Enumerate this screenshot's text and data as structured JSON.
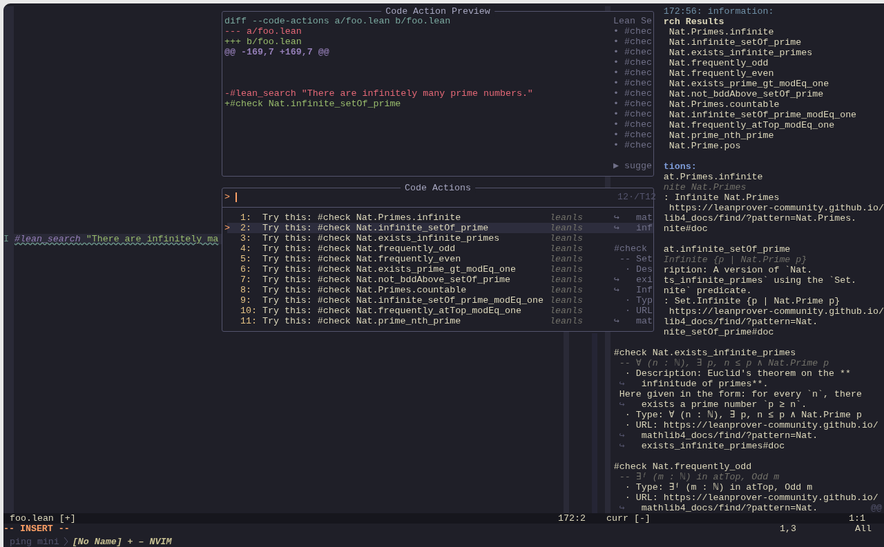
{
  "editor": {
    "file_line": {
      "sign": "I",
      "segments": [
        {
          "kind": "keyword",
          "text": "#lean_search"
        },
        {
          "kind": "string",
          "text": " \"There are infinitely ma"
        }
      ]
    }
  },
  "preview": {
    "title": "Code Action Preview",
    "lines": [
      {
        "kind": "header",
        "text": "diff --code-actions a/foo.lean b/foo.lean",
        "underlay": "Lean Se"
      },
      {
        "kind": "removed",
        "text": "--- a/foo.lean",
        "underlay": "• #chec"
      },
      {
        "kind": "added",
        "text": "+++ b/foo.lean",
        "underlay": "• #chec"
      },
      {
        "kind": "hunk",
        "text": "@@ -169,7 +169,7 @@",
        "underlay": "• #chec"
      },
      {
        "kind": "blank",
        "underlay": "• #chec"
      },
      {
        "kind": "blank",
        "underlay": "• #chec"
      },
      {
        "kind": "blank",
        "underlay": "• #chec"
      },
      {
        "kind": "removed",
        "text": "-#lean_search \"There are infinitely many prime numbers.\"",
        "underlay": "• #chec"
      },
      {
        "kind": "added",
        "text": "+#check Nat.infinite_setOf_prime",
        "underlay": "• #chec"
      },
      {
        "kind": "blank",
        "underlay": "• #chec"
      },
      {
        "kind": "blank",
        "underlay": "• #chec"
      },
      {
        "kind": "blank",
        "underlay": "• #chec"
      },
      {
        "kind": "blank",
        "underlay": "• #chec"
      },
      {
        "kind": "blank"
      },
      {
        "kind": "blank",
        "underlay": "▶ sugge"
      }
    ]
  },
  "code_actions": {
    "title": "Code Actions",
    "prompt": ">",
    "counter": "12·/T12",
    "items": [
      {
        "number": "1:",
        "title": "Try this: #check Nat.Primes.infinite",
        "source": "leanls",
        "selected": false,
        "underlay": "↪   mat"
      },
      {
        "number": "2:",
        "title": "Try this: #check Nat.infinite_setOf_prime",
        "source": "leanls",
        "selected": true,
        "marker": ">",
        "underlay": "↪   inf"
      },
      {
        "number": "3:",
        "title": "Try this: #check Nat.exists_infinite_primes",
        "source": "leanls",
        "selected": false
      },
      {
        "number": "4:",
        "title": "Try this: #check Nat.frequently_odd",
        "source": "leanls",
        "selected": false,
        "underlay": "#check"
      },
      {
        "number": "5:",
        "title": "Try this: #check Nat.frequently_even",
        "source": "leanls",
        "selected": false,
        "underlay": " -- Set"
      },
      {
        "number": "6:",
        "title": "Try this: #check Nat.exists_prime_gt_modEq_one",
        "source": "leanls",
        "selected": false,
        "underlay": "  · Des"
      },
      {
        "number": "7:",
        "title": "Try this: #check Nat.not_bddAbove_setOf_prime",
        "source": "leanls",
        "selected": false,
        "underlay": "↪   exi"
      },
      {
        "number": "8:",
        "title": "Try this: #check Nat.Primes.countable",
        "source": "leanls",
        "selected": false,
        "underlay": "↪   Inf"
      },
      {
        "number": "9:",
        "title": "Try this: #check Nat.infinite_setOf_prime_modEq_one",
        "source": "leanls",
        "selected": false,
        "underlay": "  · Typ"
      },
      {
        "number": "10:",
        "title": "Try this: #check Nat.frequently_atTop_modEq_one",
        "source": "leanls",
        "selected": false,
        "underlay": "  · URL"
      },
      {
        "number": "11:",
        "title": "Try this: #check Nat.prime_nth_prime",
        "source": "leanls",
        "selected": false,
        "underlay": "↪   mat"
      }
    ]
  },
  "infoview": {
    "covered_lines": [
      {
        "kind": "info",
        "text": "172:56: information:"
      },
      {
        "kind": "heading",
        "text": "rch Results"
      },
      {
        "kind": "text",
        "text": " Nat.Primes.infinite"
      },
      {
        "kind": "text",
        "text": " Nat.infinite_setOf_prime"
      },
      {
        "kind": "text",
        "text": " Nat.exists_infinite_primes"
      },
      {
        "kind": "text",
        "text": " Nat.frequently_odd"
      },
      {
        "kind": "text",
        "text": " Nat.frequently_even"
      },
      {
        "kind": "text",
        "text": " Nat.exists_prime_gt_modEq_one"
      },
      {
        "kind": "text",
        "text": " Nat.not_bddAbove_setOf_prime"
      },
      {
        "kind": "text",
        "text": " Nat.Primes.countable"
      },
      {
        "kind": "text",
        "text": " Nat.infinite_setOf_prime_modEq_one"
      },
      {
        "kind": "text",
        "text": " Nat.frequently_atTop_modEq_one"
      },
      {
        "kind": "text",
        "text": " Nat.prime_nth_prime"
      },
      {
        "kind": "text",
        "text": " Nat.Prime.pos"
      },
      {
        "kind": "blank"
      },
      {
        "kind": "section",
        "text": "tions:"
      },
      {
        "kind": "text",
        "text": "at.Primes.infinite"
      },
      {
        "kind": "type",
        "text": "nite Nat.Primes"
      },
      {
        "kind": "text",
        "text": ": Infinite Nat.Primes"
      },
      {
        "kind": "text",
        "text": " https://leanprover-community.github.io/"
      },
      {
        "kind": "text",
        "text": "lib4_docs/find/?pattern=Nat.Primes."
      },
      {
        "kind": "text",
        "text": "nite#doc"
      },
      {
        "kind": "blank"
      },
      {
        "kind": "text",
        "text": "at.infinite_setOf_prime"
      },
      {
        "kind": "type",
        "text": "Infinite {p | Nat.Prime p}"
      },
      {
        "kind": "text",
        "text": "ription: A version of `Nat."
      },
      {
        "kind": "text",
        "text": "ts_infinite_primes` using the `Set."
      },
      {
        "kind": "text",
        "text": "nite` predicate."
      },
      {
        "kind": "text",
        "text": ": Set.Infinite {p | Nat.Prime p}"
      },
      {
        "kind": "text",
        "text": " https://leanprover-community.github.io/"
      },
      {
        "kind": "text",
        "text": "lib4_docs/find/?pattern=Nat."
      },
      {
        "kind": "text",
        "text": "nite_setOf_prime#doc"
      },
      {
        "kind": "blank"
      }
    ],
    "lines": [
      {
        "kind": "text",
        "text": "#check Nat.exists_infinite_primes"
      },
      {
        "kind": "type",
        "text": " -- ∀ (n : ℕ), ∃ p, n ≤ p ∧ Nat.Prime p"
      },
      {
        "kind": "text",
        "text": "  · Description: Euclid's theorem on the **"
      },
      {
        "kind": "wrap",
        "mark": "↪",
        "text": "infinitude of primes**."
      },
      {
        "kind": "text",
        "text": " Here given in the form: for every `n`, there"
      },
      {
        "kind": "wrap",
        "mark": "↪",
        "text": "exists a prime number `p ≥ n`."
      },
      {
        "kind": "text",
        "text": "  · Type: ∀ (n : ℕ), ∃ p, n ≤ p ∧ Nat.Prime p"
      },
      {
        "kind": "text",
        "text": "  · URL: https://leanprover-community.github.io/"
      },
      {
        "kind": "wrap",
        "mark": "↪",
        "text": "mathlib4_docs/find/?pattern=Nat."
      },
      {
        "kind": "wrap",
        "mark": "↪",
        "text": "exists_infinite_primes#doc"
      },
      {
        "kind": "blank"
      },
      {
        "kind": "text",
        "text": "#check Nat.frequently_odd"
      },
      {
        "kind": "type",
        "text": " -- ∃ᶠ (m : ℕ) in atTop, Odd m"
      },
      {
        "kind": "text",
        "text": "  · Type: ∃ᶠ (m : ℕ) in atTop, Odd m"
      },
      {
        "kind": "text",
        "text": "  · URL: https://leanprover-community.github.io/"
      },
      {
        "kind": "wrap",
        "mark": "↪",
        "text": "mathlib4_docs/find/?pattern=Nat.",
        "trailing": "@@"
      }
    ]
  },
  "status_line": {
    "left_file": "foo.lean [+]",
    "left_position": "172:2",
    "right_file": "curr [-]",
    "right_position": "1:1"
  },
  "command_line": {
    "mode": "-- INSERT --",
    "ruler": "1,3",
    "scroll": "All"
  },
  "tabline": {
    "session": "ping mini",
    "title": "[No Name] + – NVIM"
  }
}
